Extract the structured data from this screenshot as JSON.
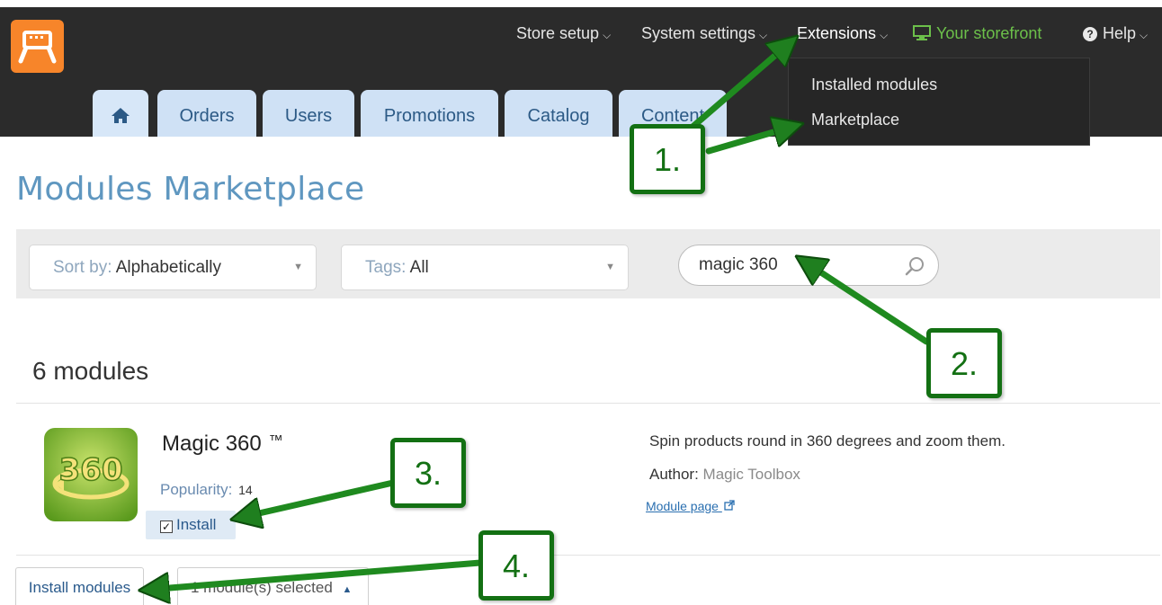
{
  "header": {
    "nav": {
      "store_setup": "Store setup",
      "system_settings": "System settings",
      "extensions": "Extensions",
      "storefront": "Your storefront",
      "help": "Help"
    },
    "extensions_menu": {
      "installed_modules": "Installed modules",
      "marketplace": "Marketplace"
    },
    "tabs": [
      "Orders",
      "Users",
      "Promotions",
      "Catalog",
      "Content"
    ]
  },
  "page": {
    "title": "Modules Marketplace"
  },
  "filters": {
    "sort_label": "Sort by:",
    "sort_value": "Alphabetically",
    "tags_label": "Tags:",
    "tags_value": "All",
    "search_value": "magic 360"
  },
  "results": {
    "count_text": "6 modules",
    "module": {
      "name": "Magic 360",
      "trademark": "™",
      "popularity_label": "Popularity:",
      "popularity_value": "14",
      "install_label": "Install",
      "description": "Spin products round in 360 degrees and zoom them.",
      "author_label": "Author:",
      "author_value": "Magic Toolbox",
      "module_page_link": "Module page",
      "icon_text": "360"
    }
  },
  "footer_actions": {
    "install_button": "Install modules",
    "selected_text": "1 module(s) selected"
  },
  "annotations": {
    "step1": "1.",
    "step2": "2.",
    "step3": "3.",
    "step4": "4."
  },
  "colors": {
    "header_bg": "#2b2b2b",
    "logo_bg": "#f7852a",
    "tab_bg": "#cfe1f5",
    "title_color": "#5f97c0",
    "storefront_green": "#6cc04a",
    "annotation_green": "#137013"
  }
}
